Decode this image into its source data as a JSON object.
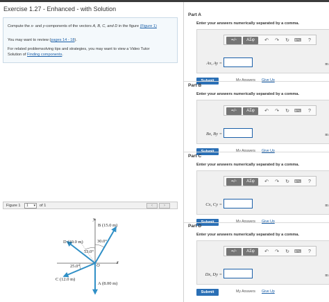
{
  "exercise": {
    "title": "Exercise 1.27 - Enhanced - with Solution",
    "prompt_pre": "Compute the ",
    "prompt_x": "x",
    "prompt_mid1": "- and ",
    "prompt_y": "y",
    "prompt_mid2": "-components of the vectors ",
    "prompt_vectors": "A, B, C, and D",
    "prompt_post": " in the figure ",
    "figure_link": "(Figure 1)",
    "review_pre": "You may want to review (",
    "review_link": "pages 14 - 18",
    "review_post": ").",
    "related_line1": "For related problemsolving tips and strategies, you may want to view a Video Tutor",
    "related_pre": "Solution of ",
    "related_link": "Finding components",
    "related_post": "."
  },
  "figure": {
    "label": "Figure 1",
    "select_value": "1",
    "of_text": "of 1",
    "prev_icon": "chevron-left-icon",
    "next_icon": "chevron-right-icon",
    "vectors": {
      "B": "B (15.0 m)",
      "D": "D (10.0 m)",
      "C": "C (12.0 m)",
      "A": "A (8.00 m)"
    },
    "angles": {
      "a30": "30.0°",
      "a53": "53.0°",
      "a25": "25.0°"
    },
    "axes": {
      "y": "y",
      "x": "x",
      "origin": "O"
    }
  },
  "toolbar": {
    "template_btn": "▪√▫",
    "greek_btn": "ΑΣφ",
    "undo_icon": "undo-icon",
    "redo_icon": "redo-icon",
    "reset_icon": "reset-icon",
    "keyboard_icon": "keyboard-icon",
    "help_label": "?"
  },
  "parts": [
    {
      "title": "Part A",
      "instruction": "Enter your answers numerically separated by a comma.",
      "label": "Ax, Ay =",
      "value": "",
      "unit": "m"
    },
    {
      "title": "Part B",
      "instruction": "Enter your answers numerically separated by a comma.",
      "label": "Bx, By =",
      "value": "",
      "unit": "m"
    },
    {
      "title": "Part C",
      "instruction": "Enter your answers numerically separated by a comma.",
      "label": "Cx, Cy =",
      "value": "",
      "unit": "m"
    },
    {
      "title": "Part D",
      "instruction": "Enter your answers numerically separated by a comma.",
      "label": "Dx, Dy =",
      "value": "",
      "unit": "m"
    }
  ],
  "actions": {
    "submit": "Submit",
    "my_answers": "My Answers",
    "give_up": "Give Up"
  },
  "colors": {
    "accent": "#2a6fb5",
    "vector": "#2f8fc6",
    "link": "#1a5fa8"
  }
}
